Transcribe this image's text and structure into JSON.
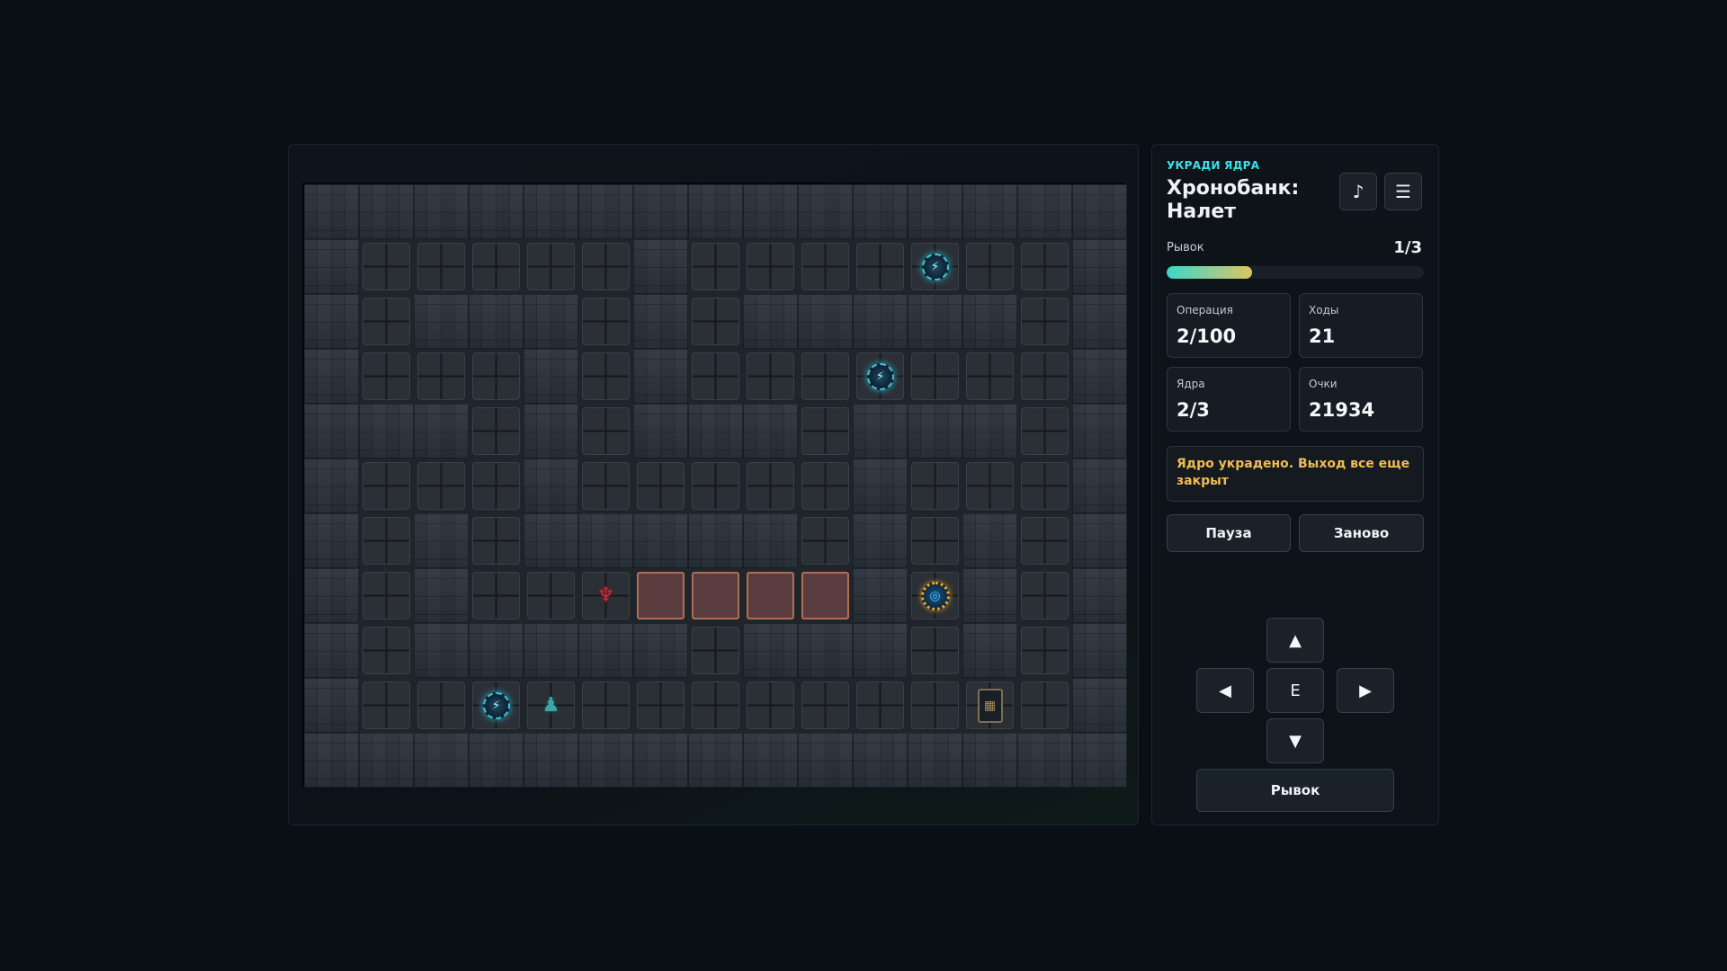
{
  "game": {
    "board": {
      "cols": 15,
      "rows": 11,
      "map": [
        "WWWWWWWWWWWWWWW",
        "WFFFFFWFFFFFFFW",
        "WFWWWFWFWWWWWFW",
        "WFFFWFWFFFFFFFW",
        "WWWFWFWWWFWWWFW",
        "WFFFWFFFFFWFFFW",
        "WFWFWWWWWFWFWFW",
        "WFWFFFLLLLWFWFW",
        "WFWWWWWFWWWFWFW",
        "WFFFFFFFFFFFFFW",
        "WWWWWWWWWWWWWWW"
      ],
      "entities": [
        {
          "type": "core",
          "icon": "core-icon",
          "row": 1,
          "col": 11
        },
        {
          "type": "core",
          "icon": "core-icon",
          "row": 3,
          "col": 10
        },
        {
          "type": "core",
          "icon": "core-icon",
          "row": 9,
          "col": 3
        },
        {
          "type": "guard",
          "icon": "guard-icon",
          "row": 7,
          "col": 5
        },
        {
          "type": "exit",
          "icon": "exit-icon",
          "row": 7,
          "col": 11
        },
        {
          "type": "player",
          "icon": "player-icon",
          "row": 9,
          "col": 4
        },
        {
          "type": "vault",
          "icon": "vault-icon",
          "row": 9,
          "col": 12
        }
      ]
    }
  },
  "sidebar": {
    "tag": "УКРАДИ ЯДРА",
    "title": "Хронобанк: Налет",
    "music_icon": "music-note-icon",
    "menu_icon": "menu-icon",
    "dash": {
      "label": "Рывок",
      "count": "1/3",
      "fraction": 0.333
    },
    "stats": [
      {
        "label": "Операция",
        "value": "2/100"
      },
      {
        "label": "Ходы",
        "value": "21"
      },
      {
        "label": "Ядра",
        "value": "2/3"
      },
      {
        "label": "Очки",
        "value": "21934"
      }
    ],
    "status": "Ядро украдено. Выход все еще закрыт",
    "buttons": {
      "pause": "Пауза",
      "restart": "Заново",
      "dash": "Рывок"
    },
    "dpad": {
      "up": "▲",
      "left": "◀",
      "center": "E",
      "right": "▶",
      "down": "▼"
    },
    "colors": {
      "accent": "#3de0e8",
      "status": "#f1bd52",
      "dash_start": "#3dd6c7",
      "dash_end": "#dcc566"
    }
  }
}
